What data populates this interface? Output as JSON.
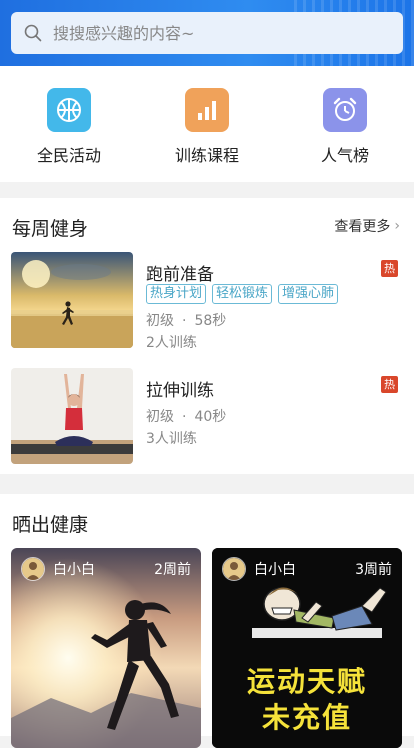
{
  "search": {
    "placeholder": "搜搜感兴趣的内容~"
  },
  "quick": [
    {
      "label": "全民活动",
      "icon": "basketball-icon",
      "color": "#43b8ea"
    },
    {
      "label": "训练课程",
      "icon": "bar-chart-icon",
      "color": "#f0a25a"
    },
    {
      "label": "人气榜",
      "icon": "alarm-clock-icon",
      "color": "#8b93ea"
    }
  ],
  "weekly": {
    "title": "每周健身",
    "more": "查看更多",
    "courses": [
      {
        "title": "跑前准备",
        "hot": "热",
        "tags": [
          "热身计划",
          "轻松锻炼",
          "增强心肺"
        ],
        "level": "初级",
        "duration": "58秒",
        "trainees": "2人训练"
      },
      {
        "title": "拉伸训练",
        "hot": "热",
        "level": "初级",
        "duration": "40秒",
        "trainees": "3人训练"
      }
    ]
  },
  "show": {
    "title": "晒出健康",
    "posts": [
      {
        "user": "白小白",
        "time": "2周前"
      },
      {
        "user": "白小白",
        "time": "3周前",
        "caption_line1": "运动天赋",
        "caption_line2": "未充值"
      }
    ]
  },
  "colors": {
    "header_blue": "#2f8cf0",
    "hot_red": "#d9472b",
    "tag_blue": "#4aa6c7"
  }
}
